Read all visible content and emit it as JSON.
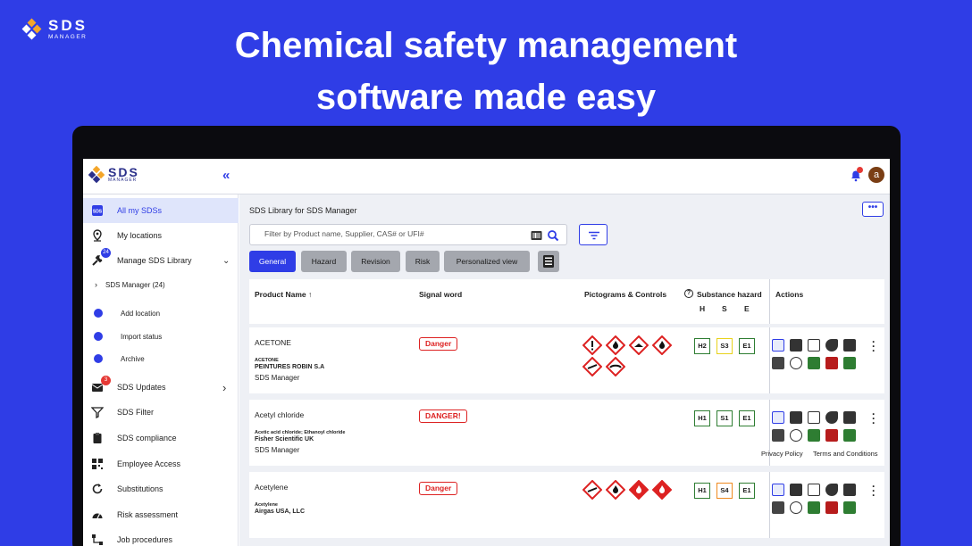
{
  "brand": {
    "name": "SDS",
    "sub": "MANAGER"
  },
  "hero": {
    "line1": "Chemical safety management",
    "line2": "software made easy"
  },
  "app": {
    "logo": {
      "name": "SDS",
      "sub": "MANAGER"
    },
    "collapse_glyph": "«",
    "avatar_letter": "a"
  },
  "sidebar": {
    "items": [
      {
        "label": "All my SDSs",
        "icon": "sds-icon"
      },
      {
        "label": "My locations",
        "icon": "location-pin-icon"
      },
      {
        "label": "Manage SDS Library",
        "icon": "wrench-icon",
        "badge": "24",
        "chev": "⌄"
      },
      {
        "label": "SDS Updates",
        "icon": "mail-icon",
        "badge": "3",
        "chev": "›"
      },
      {
        "label": "SDS Filter",
        "icon": "filter-icon"
      },
      {
        "label": "SDS compliance",
        "icon": "clipboard-icon"
      },
      {
        "label": "Employee Access",
        "icon": "qr-code-icon"
      },
      {
        "label": "Substitutions",
        "icon": "refresh-icon"
      },
      {
        "label": "Risk assessment",
        "icon": "gauge-icon"
      },
      {
        "label": "Job procedures",
        "icon": "flow-icon"
      }
    ],
    "library_node": "SDS Manager (24)",
    "sub_items": [
      "Add location",
      "Import status",
      "Archive"
    ]
  },
  "main": {
    "title": "SDS Library for SDS Manager",
    "more_label": "•••",
    "search_placeholder": "Filter by Product name, Supplier, CAS# or UFI#",
    "tabs": [
      "General",
      "Hazard",
      "Revision",
      "Risk",
      "Personalized view"
    ],
    "columns": {
      "product": "Product Name",
      "sort_glyph": "↑",
      "signal": "Signal word",
      "pictograms": "Pictograms & Controls",
      "hazard": "Substance hazard",
      "hazard_help": "?",
      "h": "H",
      "s": "S",
      "e": "E",
      "actions": "Actions"
    },
    "rows": [
      {
        "name": "ACETONE",
        "sub": "ACETONE",
        "supplier": "PEINTURES ROBIN S.A",
        "library": "SDS Manager",
        "signal": "Danger",
        "pictos": [
          "exclamation",
          "flame",
          "corrosion",
          "flame"
        ],
        "pictos2": [
          "no-entry",
          "goggles"
        ],
        "h": "H2",
        "s": "S3",
        "e": "E1",
        "s_color": "#e8d21b"
      },
      {
        "name": "Acetyl chloride",
        "sub": "Acetic acid chloride; Ethanoyl chloride",
        "supplier": "Fisher Scientific UK",
        "library": "SDS Manager",
        "signal": "DANGER!",
        "pictos": [],
        "pictos2": [],
        "h": "H1",
        "s": "S1",
        "e": "E1",
        "s_color": "#2e7d32"
      },
      {
        "name": "Acetylene",
        "sub": "Acetylene",
        "supplier": "Airgas USA, LLC",
        "library": "",
        "signal": "Danger",
        "pictos": [
          "no-entry",
          "flame",
          "flame-red",
          "flame-red"
        ],
        "pictos2": [],
        "h": "H1",
        "s": "S4",
        "e": "E1",
        "s_color": "#ef8a1e"
      }
    ]
  },
  "footer": {
    "privacy": "Privacy Policy",
    "terms": "Terms and Conditions"
  },
  "colors": {
    "accent": "#2f3de6",
    "danger": "#d22222",
    "green": "#2e7d32",
    "red_action": "#b71c1c"
  }
}
